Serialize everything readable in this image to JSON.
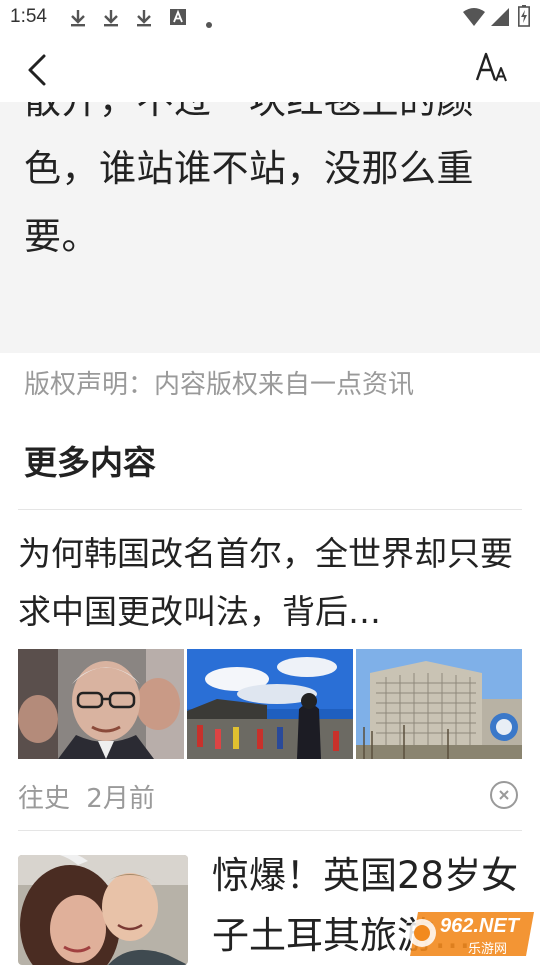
{
  "status_bar": {
    "time": "1:54",
    "icons": [
      "download-icon",
      "download-icon",
      "download-icon",
      "font-a-icon",
      "dot-icon",
      "wifi-icon",
      "signal-icon",
      "battery-icon"
    ]
  },
  "nav": {
    "back_icon": "chevron-left-icon",
    "font_icon": "font-size-icon"
  },
  "article": {
    "quote_text": "散开，不过一块红毯上的颜色，谁站谁不站，没那么重要。",
    "copyright": "版权声明：内容版权来自一点资讯"
  },
  "more": {
    "title": "更多内容",
    "items": [
      {
        "title": "为何韩国改名首尔，全世界却只要求中国更改叫法，背后…",
        "source": "往史",
        "time": "2月前",
        "images": [
          "elderly-man-glasses-photo",
          "palace-guards-photo",
          "government-building-photo"
        ]
      },
      {
        "title": "惊爆！英国28岁女子土耳其旅游…",
        "image": "couple-selfie-photo"
      }
    ]
  },
  "watermark": {
    "text": "962.NET",
    "sub": "乐游网"
  },
  "colors": {
    "quote_bg": "#f4f4f4",
    "muted_text": "#9a9a9a",
    "divider": "#e5e5e5",
    "watermark": "#f28a1e"
  }
}
